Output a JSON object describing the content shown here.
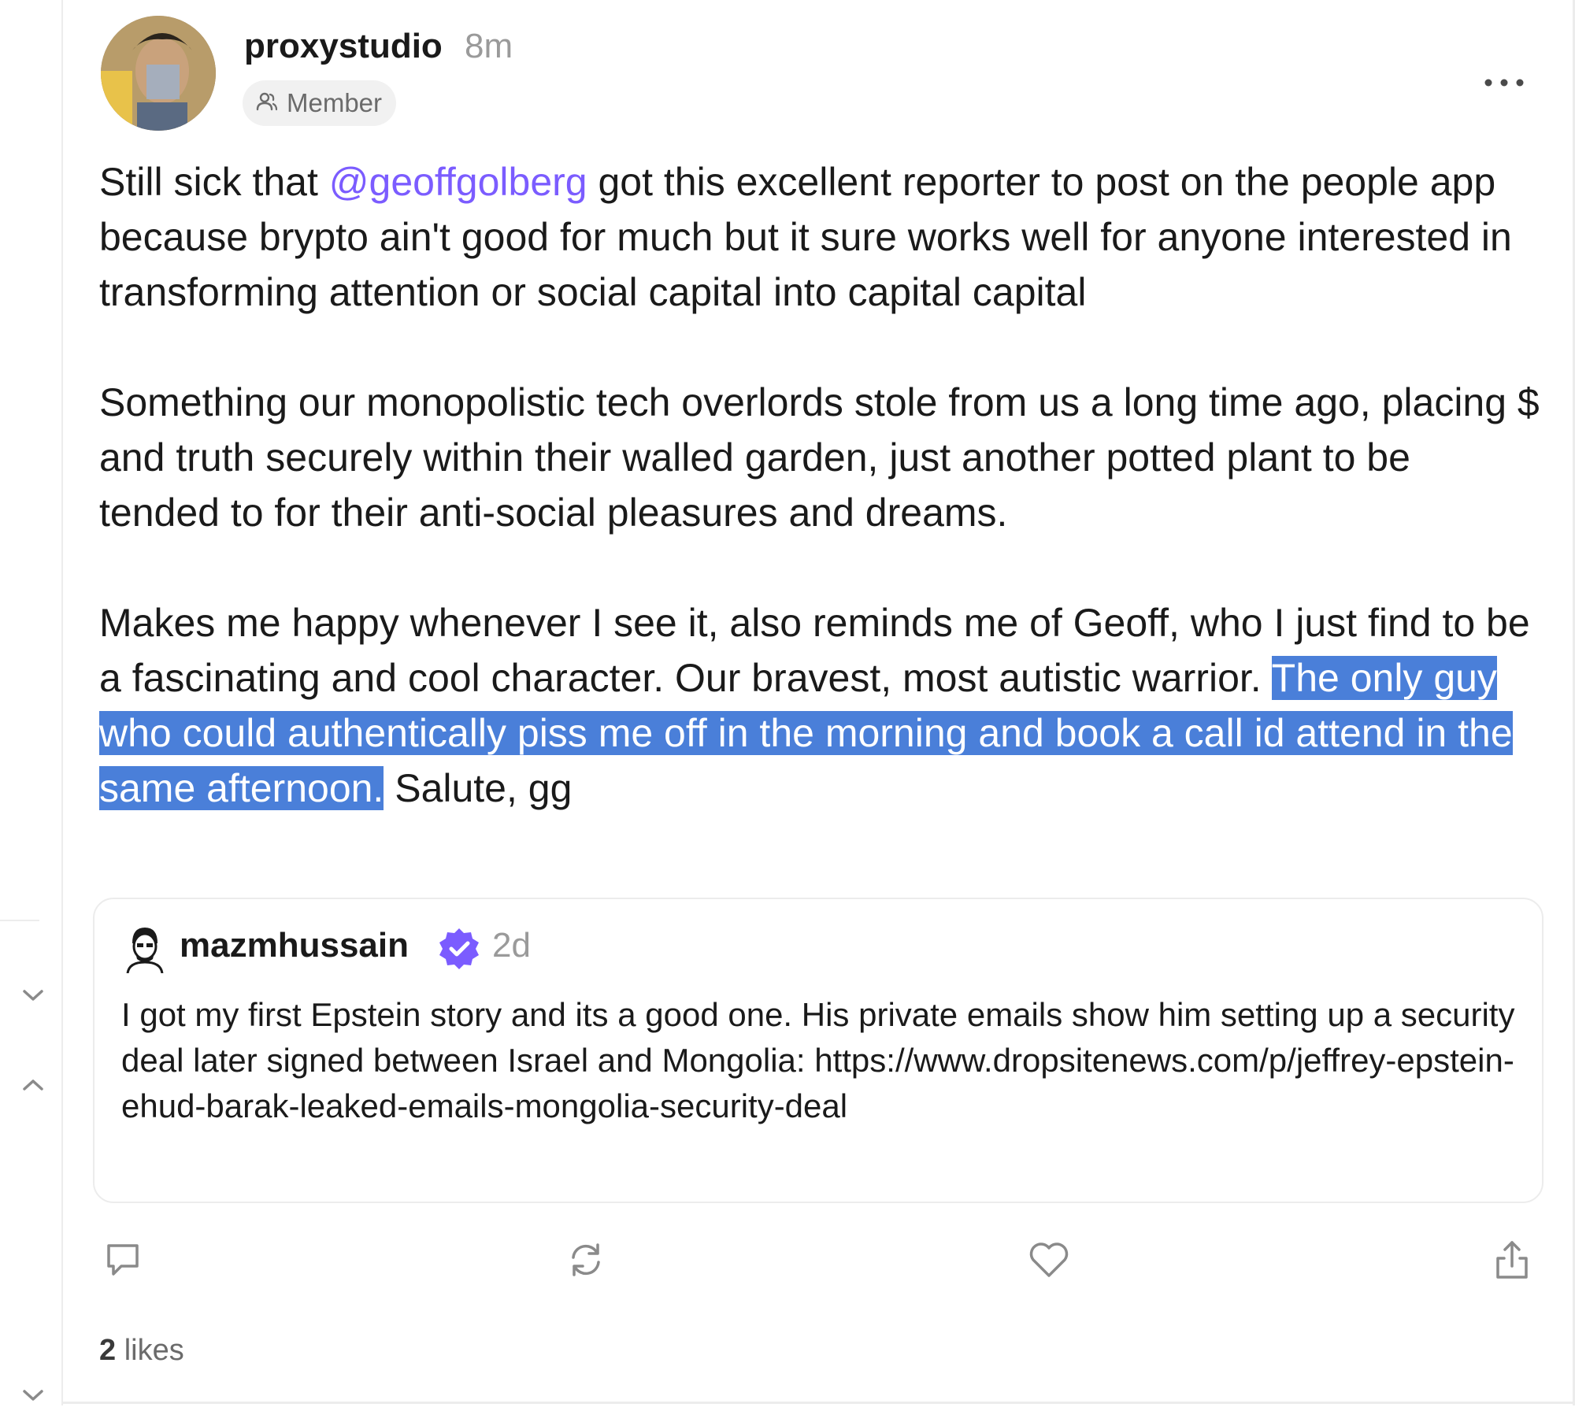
{
  "post": {
    "author": "proxystudio",
    "time": "8m",
    "badge": "Member",
    "paragraph1": {
      "before": "Still sick that ",
      "mention": "@geoffgolberg",
      "after": " got this excellent reporter to post on the people app because brypto ain't good for much but it sure works well for anyone interested in transforming attention or social capital into capital capital"
    },
    "paragraph2": "Something our monopolistic tech overlords stole from us a long time ago, placing $ and truth securely within their walled garden, just another potted plant to be tended to for their anti-social pleasures and dreams.",
    "paragraph3": {
      "before": "Makes me happy whenever I see it, also reminds me of Geoff, who I just find to be a fascinating and cool character. Our bravest, most autistic warrior. ",
      "highlighted": "The only guy who could authentically piss me off in the morning and book a call id attend in the same afternoon.",
      "after": " Salute, gg"
    }
  },
  "quote": {
    "author": "mazmhussain",
    "time": "2d",
    "text": "I got my first Epstein story and its a good one. His private emails show him setting up a security deal later signed between Israel and Mongolia: https://www.dropsitenews.com/p/jeffrey-epstein-ehud-barak-leaked-emails-mongolia-security-deal"
  },
  "likes": {
    "count": "2",
    "label": "likes"
  },
  "icons": {
    "more": "more-horizontal-icon",
    "badge": "users-icon",
    "verified": "verified-badge-icon",
    "reply": "comment-icon",
    "recast": "recast-icon",
    "like": "heart-icon",
    "share": "share-icon",
    "rail_down": "chevron-down-icon",
    "rail_up": "chevron-up-icon"
  },
  "colors": {
    "mention": "#7b5cff",
    "highlight": "#4a7fd9",
    "verified": "#7b5cff",
    "muted": "#9a9a9a"
  }
}
